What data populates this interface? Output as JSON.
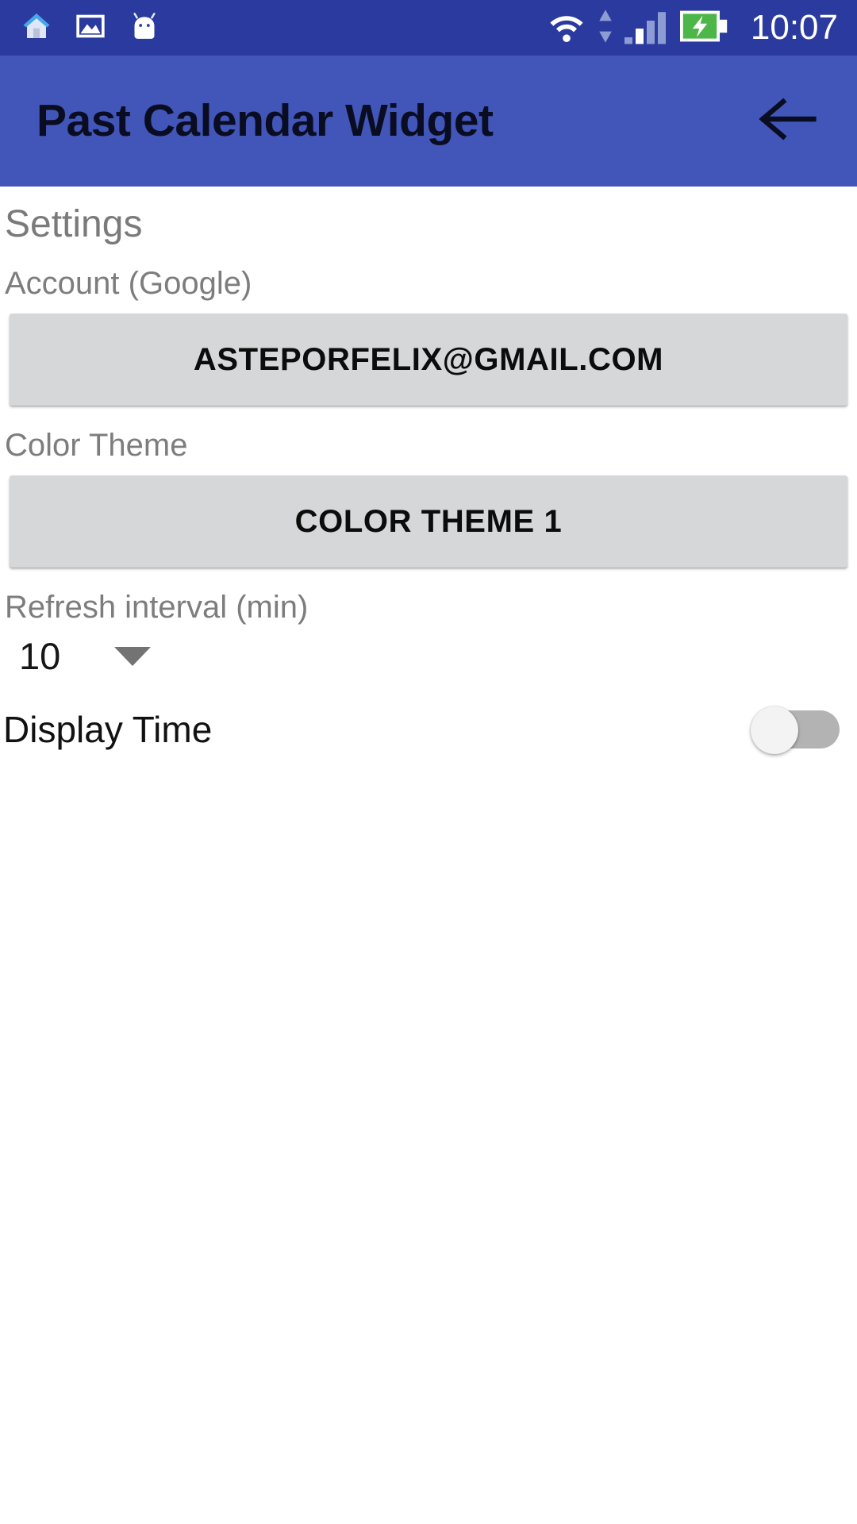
{
  "status_bar": {
    "icons": [
      "home-icon",
      "photo-icon",
      "android-head-icon"
    ],
    "wifi_icon": "wifi-icon",
    "data-transfer-icon": "data-up-down-icon",
    "signal_icon": "cellular-signal-icon",
    "battery_icon": "battery-charging-icon",
    "time": "10:07",
    "background_color": "#2b3a9e"
  },
  "app_bar": {
    "title": "Past Calendar Widget",
    "back_icon": "back-arrow-icon",
    "background_color": "#4156b8",
    "title_color": "#0a0d22"
  },
  "settings": {
    "heading": "Settings",
    "account": {
      "label": "Account (Google)",
      "value": "ASTEPORFELIX@GMAIL.COM"
    },
    "color_theme": {
      "label": "Color Theme",
      "value": "COLOR THEME 1"
    },
    "refresh_interval": {
      "label": "Refresh interval (min)",
      "value": "10",
      "caret_icon": "dropdown-caret-icon"
    },
    "display_time": {
      "label": "Display Time",
      "state": "off"
    }
  },
  "colors": {
    "button_bg": "#d5d7d8",
    "label_gray": "#7d7d7d",
    "switch_track_off": "#b3b3b3",
    "switch_thumb": "#f3f3f3"
  }
}
